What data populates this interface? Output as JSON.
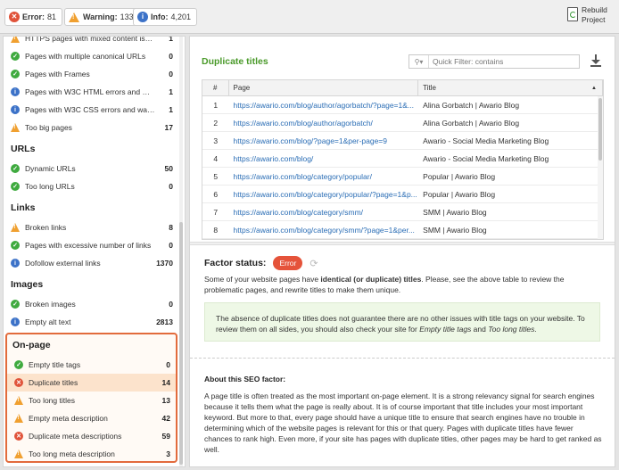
{
  "topbar": {
    "error_label": "Error:",
    "error_count": "81",
    "warning_label": "Warning:",
    "warning_count": "133",
    "info_label": "Info:",
    "info_count": "4,201",
    "rebuild_line1": "Rebuild",
    "rebuild_line2": "Project"
  },
  "sidebar": {
    "top_rows": [
      {
        "icon": "warning",
        "label": "HTTPS pages with mixed content issues",
        "count": "1"
      },
      {
        "icon": "ok",
        "label": "Pages with multiple canonical URLs",
        "count": "0"
      },
      {
        "icon": "ok",
        "label": "Pages with Frames",
        "count": "0"
      },
      {
        "icon": "info",
        "label": "Pages with W3C HTML errors and warni...",
        "count": "1"
      },
      {
        "icon": "info",
        "label": "Pages with W3C CSS errors and warnin...",
        "count": "1"
      },
      {
        "icon": "warning",
        "label": "Too big pages",
        "count": "17"
      }
    ],
    "urls_title": "URLs",
    "urls_rows": [
      {
        "icon": "ok",
        "label": "Dynamic URLs",
        "count": "50"
      },
      {
        "icon": "ok",
        "label": "Too long URLs",
        "count": "0"
      }
    ],
    "links_title": "Links",
    "links_rows": [
      {
        "icon": "warning",
        "label": "Broken links",
        "count": "8"
      },
      {
        "icon": "ok",
        "label": "Pages with excessive number of links",
        "count": "0"
      },
      {
        "icon": "info",
        "label": "Dofollow external links",
        "count": "1370"
      }
    ],
    "images_title": "Images",
    "images_rows": [
      {
        "icon": "ok",
        "label": "Broken images",
        "count": "0"
      },
      {
        "icon": "info",
        "label": "Empty alt text",
        "count": "2813"
      }
    ],
    "onpage_title": "On-page",
    "onpage_rows": [
      {
        "icon": "ok",
        "label": "Empty title tags",
        "count": "0"
      },
      {
        "icon": "error",
        "label": "Duplicate titles",
        "count": "14"
      },
      {
        "icon": "warning",
        "label": "Too long titles",
        "count": "13"
      },
      {
        "icon": "warning",
        "label": "Empty meta description",
        "count": "42"
      },
      {
        "icon": "error",
        "label": "Duplicate meta descriptions",
        "count": "59"
      },
      {
        "icon": "warning",
        "label": "Too long meta description",
        "count": "3"
      }
    ]
  },
  "main": {
    "title": "Duplicate titles",
    "filter_placeholder": "Quick Filter: contains",
    "table_headers": [
      "#",
      "Page",
      "Title"
    ],
    "rows": [
      {
        "n": "1",
        "page": "https://awario.com/blog/author/agorbatch/?page=1&...",
        "title": "Alina Gorbatch | Awario Blog"
      },
      {
        "n": "2",
        "page": "https://awario.com/blog/author/agorbatch/",
        "title": "Alina Gorbatch | Awario Blog"
      },
      {
        "n": "3",
        "page": "https://awario.com/blog/?page=1&per-page=9",
        "title": "Awario - Social Media Marketing Blog"
      },
      {
        "n": "4",
        "page": "https://awario.com/blog/",
        "title": "Awario - Social Media Marketing Blog"
      },
      {
        "n": "5",
        "page": "https://awario.com/blog/category/popular/",
        "title": "Popular | Awario Blog"
      },
      {
        "n": "6",
        "page": "https://awario.com/blog/category/popular/?page=1&p...",
        "title": "Popular | Awario Blog"
      },
      {
        "n": "7",
        "page": "https://awario.com/blog/category/smm/",
        "title": "SMM | Awario Blog"
      },
      {
        "n": "8",
        "page": "https://awario.com/blog/category/smm/?page=1&per...",
        "title": "SMM | Awario Blog"
      }
    ],
    "factor_status_label": "Factor status:",
    "factor_badge": "Error",
    "desc_part1": "Some of your website pages have ",
    "desc_bold": "identical (or duplicate) titles",
    "desc_part2": ". Please, see the above table to review the problematic pages, and rewrite titles to make them unique.",
    "note_part1": "The absence of duplicate titles does not guarantee there are no other issues with title tags on your website. To review them on all sides, you should also check your site for ",
    "note_italic1": "Empty title tags",
    "note_and": " and ",
    "note_italic2": "Too long titles",
    "note_end": ".",
    "about_title": "About this SEO factor:",
    "about_text": "A page title is often treated as the most important on-page element. It is a strong relevancy signal for search engines because it tells them what the page is really about. It is of course important that title includes your most important keyword. But more to that, every page should have a unique title to ensure that search engines have no trouble in determining which of the website pages is relevant for this or that query. Pages with duplicate titles have fewer chances to rank high. Even more, if your site has pages with duplicate titles, other pages may be hard to get ranked as well."
  },
  "colors": {
    "error": "#e0533a",
    "warning": "#f0a030",
    "ok": "#3faa3f",
    "info": "#3c72c8",
    "accent_green": "#4a9a2a",
    "selection": "#fce3cc",
    "highlight_border": "#e26b3c"
  }
}
